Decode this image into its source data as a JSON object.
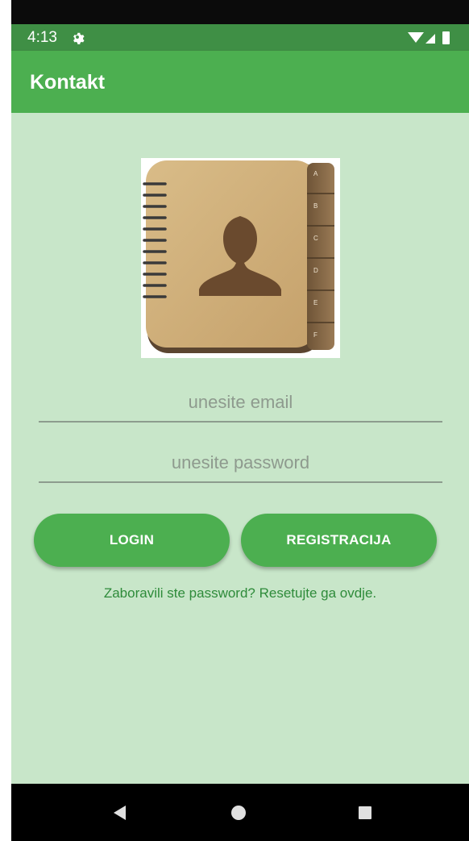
{
  "status_bar": {
    "time": "4:13",
    "icons": [
      "gear-icon",
      "wifi-icon",
      "signal-icon",
      "battery-icon"
    ]
  },
  "app_bar": {
    "title": "Kontakt"
  },
  "logo": {
    "icon": "address-book-icon",
    "tab_letters": [
      "A",
      "B",
      "C",
      "D",
      "E",
      "F"
    ]
  },
  "form": {
    "email_placeholder": "unesite email",
    "password_placeholder": "unesite password",
    "login_label": "LOGIN",
    "register_label": "REGISTRACIJA",
    "forgot_text": "Zaboravili ste password? Resetujte ga ovdje."
  },
  "nav_bar": {
    "icons": [
      "back-icon",
      "home-icon",
      "recents-icon"
    ]
  },
  "colors": {
    "status_bar": "#3f8f45",
    "app_bar": "#4caf50",
    "background": "#c8e6c9",
    "button": "#4caf50",
    "link_text": "#2e8b3a"
  }
}
